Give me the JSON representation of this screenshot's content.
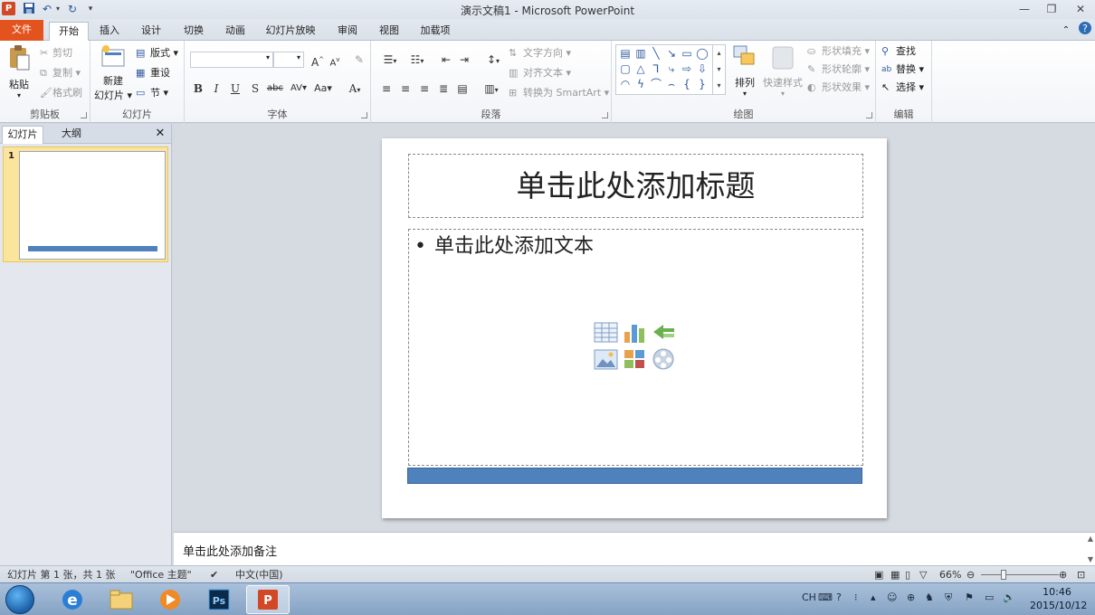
{
  "window": {
    "title": "演示文稿1 - Microsoft PowerPoint",
    "app_icon": "P",
    "qat": [
      "save-icon",
      "undo-icon",
      "redo-icon",
      "customize-icon"
    ],
    "controls": [
      "—",
      "❐",
      "✕"
    ]
  },
  "tabs": [
    {
      "label": "文件"
    },
    {
      "label": "开始"
    },
    {
      "label": "插入"
    },
    {
      "label": "设计"
    },
    {
      "label": "切换"
    },
    {
      "label": "动画"
    },
    {
      "label": "幻灯片放映"
    },
    {
      "label": "审阅"
    },
    {
      "label": "视图"
    },
    {
      "label": "加载项"
    }
  ],
  "ribbon": {
    "clipboard": {
      "paste": "粘贴",
      "cut": "剪切",
      "copy": "复制",
      "format_painter": "格式刷",
      "label": "剪贴板"
    },
    "slides": {
      "new_slide_1": "新建",
      "new_slide_2": "幻灯片",
      "layout": "版式",
      "reset": "重设",
      "section": "节",
      "label": "幻灯片"
    },
    "font": {
      "bold": "B",
      "italic": "I",
      "underline": "U",
      "shadow": "S",
      "strike": "abc",
      "spacing": "AV",
      "case": "Aa",
      "color": "A",
      "grow": "A",
      "shrink": "A",
      "label": "字体"
    },
    "paragraph": {
      "text_direction": "文字方向",
      "align_text": "对齐文本",
      "smartart": "转换为 SmartArt",
      "label": "段落"
    },
    "drawing": {
      "arrange": "排列",
      "quick_styles": "快速样式",
      "shape_fill": "形状填充",
      "shape_outline": "形状轮廓",
      "shape_effects": "形状效果",
      "label": "绘图"
    },
    "editing": {
      "find": "查找",
      "replace": "替换",
      "select": "选择",
      "label": "编辑"
    }
  },
  "pane": {
    "tab_slides": "幻灯片",
    "tab_outline": "大纲",
    "slide_number": "1"
  },
  "slide": {
    "title_placeholder": "单击此处添加标题",
    "bullet": "•",
    "body_placeholder": "单击此处添加文本",
    "accent_color": "#4f81bd"
  },
  "notes": {
    "placeholder": "单击此处添加备注"
  },
  "status": {
    "slide_info": "幻灯片 第 1 张，共 1 张",
    "theme": "\"Office 主题\"",
    "language": "中文(中国)",
    "zoom": "66%"
  },
  "taskbar": {
    "ime": "CH",
    "time": "10:46",
    "date": "2015/10/12"
  }
}
